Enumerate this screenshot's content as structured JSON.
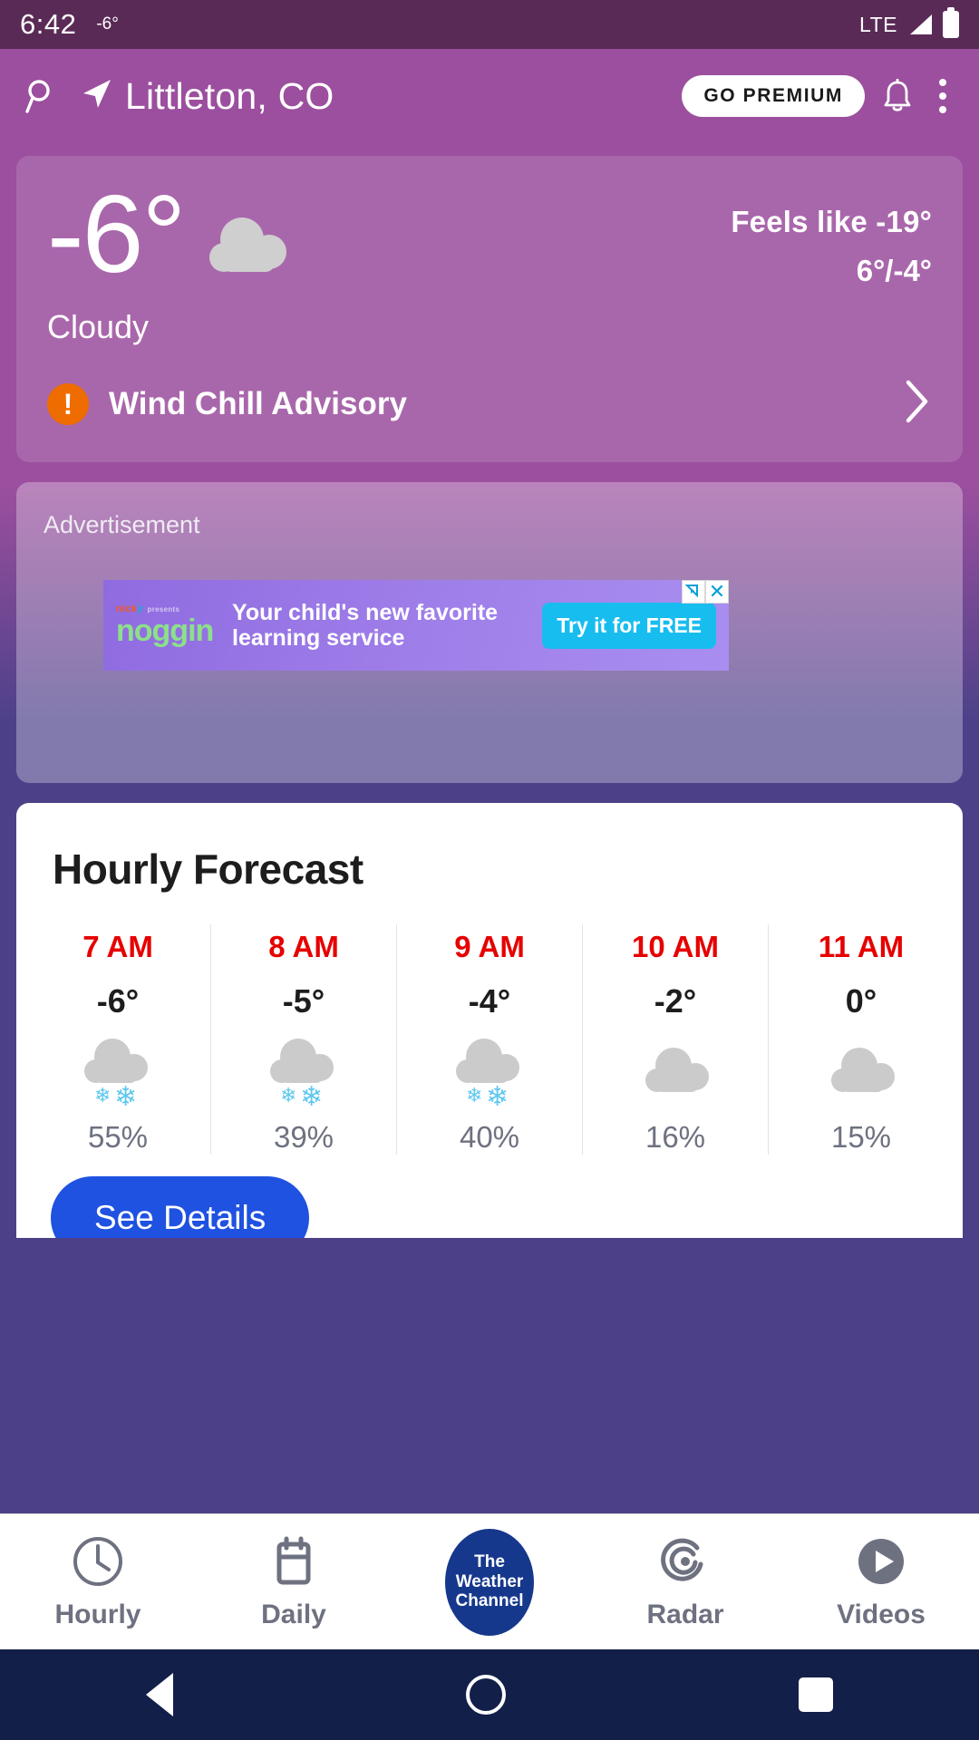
{
  "status_bar": {
    "time": "6:42",
    "temp": "-6°",
    "network": "LTE",
    "signal_icon": "signal-bars-icon",
    "battery_icon": "battery-full-icon"
  },
  "app_bar": {
    "search_icon": "search-icon",
    "location_icon": "location-arrow-icon",
    "location": "Littleton, CO",
    "premium_label": "GO PREMIUM",
    "bell_icon": "bell-icon",
    "overflow_icon": "more-vertical-icon"
  },
  "current": {
    "temperature": "-6°",
    "weather_icon": "cloudy-icon",
    "feels_like": "Feels like -19°",
    "high_low": "6°/-4°",
    "condition": "Cloudy",
    "alert": {
      "icon": "alert-exclamation-icon",
      "label": "Wind Chill Advisory",
      "chevron_icon": "chevron-right-icon"
    }
  },
  "ad": {
    "label": "Advertisement",
    "brand_top_1": "nick",
    "brand_top_2": "jr",
    "brand_top_3": "presents",
    "brand": "noggin",
    "headline": "Your child's new favorite learning service",
    "cta": "Try it for FREE",
    "adchoices_icon": "adchoices-icon",
    "close_icon": "close-icon"
  },
  "hourly": {
    "title": "Hourly Forecast",
    "columns": [
      {
        "time": "7 AM",
        "temp": "-6°",
        "icon": "snow-cloud-icon",
        "pop": "55%"
      },
      {
        "time": "8 AM",
        "temp": "-5°",
        "icon": "snow-cloud-icon",
        "pop": "39%"
      },
      {
        "time": "9 AM",
        "temp": "-4°",
        "icon": "snow-cloud-icon",
        "pop": "40%"
      },
      {
        "time": "10 AM",
        "temp": "-2°",
        "icon": "cloudy-icon",
        "pop": "16%"
      },
      {
        "time": "11 AM",
        "temp": "0°",
        "icon": "cloudy-icon",
        "pop": "15%"
      }
    ],
    "see_details": "See Details"
  },
  "tabs": [
    {
      "label": "Hourly",
      "icon": "clock-icon"
    },
    {
      "label": "Daily",
      "icon": "calendar-icon"
    },
    {
      "label": "",
      "icon": "weather-channel-logo",
      "logo_line1": "The",
      "logo_line2": "Weather",
      "logo_line3": "Channel"
    },
    {
      "label": "Radar",
      "icon": "radar-icon"
    },
    {
      "label": "Videos",
      "icon": "play-circle-icon"
    }
  ],
  "android_nav": {
    "back_icon": "back-triangle-icon",
    "home_icon": "home-circle-icon",
    "recents_icon": "recents-square-icon"
  },
  "colors": {
    "status_bar": "#5a2a56",
    "app_bar": "#9b4f9e",
    "page_bg": "#4c4189",
    "alert_orange": "#ef6c00",
    "hour_time_red": "#e60000",
    "button_blue": "#1f52e0",
    "logo_blue": "#16388c",
    "nav_bg": "#121f49"
  }
}
